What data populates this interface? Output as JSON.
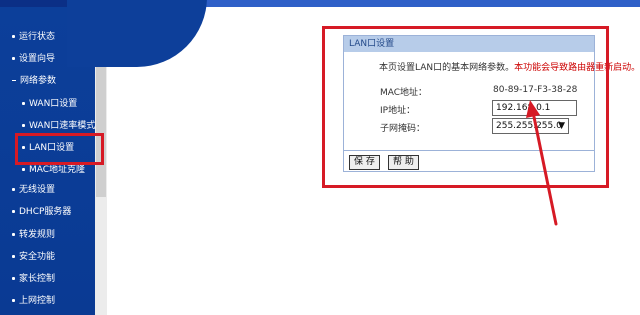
{
  "sidebar": {
    "items": [
      {
        "label": "运行状态",
        "marker": "bullet"
      },
      {
        "label": "设置向导",
        "marker": "bullet"
      },
      {
        "label": "网络参数",
        "marker": "dash"
      },
      {
        "label": "WAN口设置",
        "marker": "bullet"
      },
      {
        "label": "WAN口速率模式",
        "marker": "bullet"
      },
      {
        "label": "LAN口设置",
        "marker": "bullet"
      },
      {
        "label": "MAC地址克隆",
        "marker": "bullet"
      },
      {
        "label": "无线设置",
        "marker": "bullet"
      },
      {
        "label": "DHCP服务器",
        "marker": "bullet"
      },
      {
        "label": "转发规则",
        "marker": "bullet"
      },
      {
        "label": "安全功能",
        "marker": "bullet"
      },
      {
        "label": "家长控制",
        "marker": "bullet"
      },
      {
        "label": "上网控制",
        "marker": "bullet"
      }
    ]
  },
  "panel": {
    "title": "LAN口设置",
    "description": "本页设置LAN口的基本网络参数。",
    "warning": "本功能会导致路由器重新启动。",
    "mac_label": "MAC地址：",
    "mac_value": "80-89-17-F3-38-28",
    "ip_label": "IP地址：",
    "ip_value": "192.168.0.1",
    "mask_label": "子网掩码：",
    "mask_value": "255.255.255.0",
    "save_label": "保 存",
    "help_label": "帮 助"
  },
  "colors": {
    "sidebar_bg": "#0c3f9a",
    "highlight_box": "#d61a25",
    "panel_title_bg": "#b7cce9",
    "warning_text": "#cc0000"
  }
}
